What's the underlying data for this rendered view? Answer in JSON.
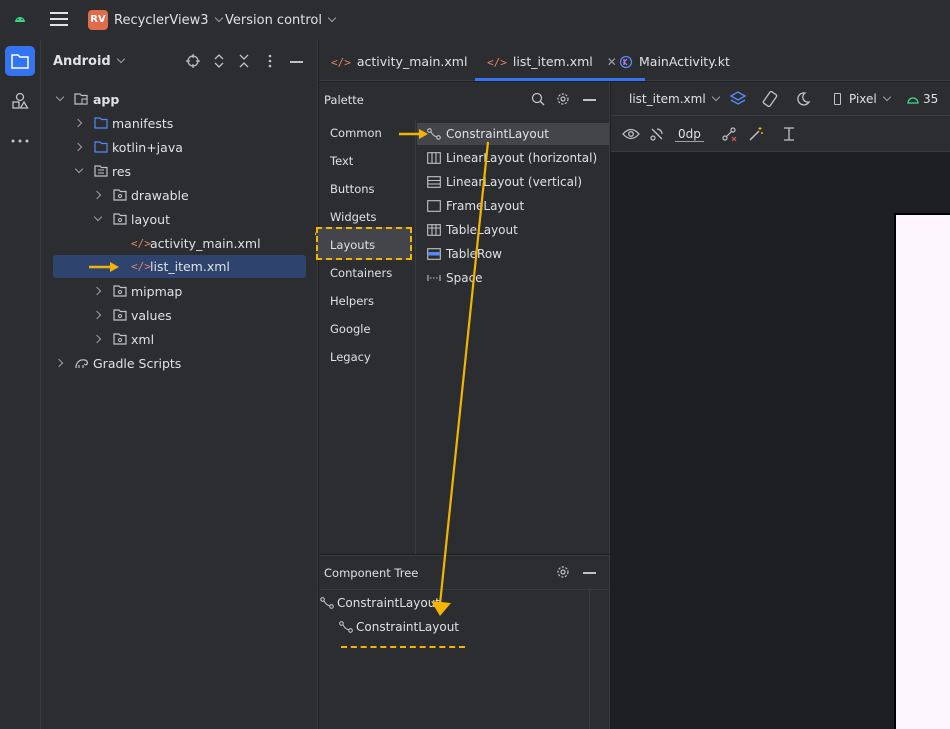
{
  "title_bar": {
    "project_badge": "RV",
    "project_name": "RecyclerView3",
    "vcs_label": "Version control"
  },
  "project_panel": {
    "view_label": "Android",
    "tree": [
      {
        "label": "app",
        "depth": 0,
        "expanded": true,
        "icon": "module-folder-icon"
      },
      {
        "label": "manifests",
        "depth": 1,
        "expanded": false,
        "icon": "folder-icon"
      },
      {
        "label": "kotlin+java",
        "depth": 1,
        "expanded": false,
        "icon": "folder-icon"
      },
      {
        "label": "res",
        "depth": 1,
        "expanded": true,
        "icon": "res-folder-icon"
      },
      {
        "label": "drawable",
        "depth": 2,
        "expanded": false,
        "icon": "res-folder-icon"
      },
      {
        "label": "layout",
        "depth": 2,
        "expanded": true,
        "icon": "res-folder-icon"
      },
      {
        "label": "activity_main.xml",
        "depth": 3,
        "icon": "xml-file-icon"
      },
      {
        "label": "list_item.xml",
        "depth": 3,
        "icon": "xml-file-icon",
        "selected": true
      },
      {
        "label": "mipmap",
        "depth": 2,
        "expanded": false,
        "icon": "res-folder-icon"
      },
      {
        "label": "values",
        "depth": 2,
        "expanded": false,
        "icon": "res-folder-icon"
      },
      {
        "label": "xml",
        "depth": 2,
        "expanded": false,
        "icon": "res-folder-icon"
      },
      {
        "label": "Gradle Scripts",
        "depth": 0,
        "expanded": false,
        "icon": "gradle-icon"
      }
    ]
  },
  "tabs": [
    {
      "label": "activity_main.xml",
      "icon": "xml-file-icon"
    },
    {
      "label": "list_item.xml",
      "icon": "xml-file-icon",
      "active": true
    },
    {
      "label": "MainActivity.kt",
      "icon": "kotlin-file-icon"
    }
  ],
  "palette": {
    "header": "Palette",
    "categories": [
      "Common",
      "Text",
      "Buttons",
      "Widgets",
      "Layouts",
      "Containers",
      "Helpers",
      "Google",
      "Legacy"
    ],
    "selected_category": "Layouts",
    "widgets": [
      {
        "label": "ConstraintLayout",
        "icon": "constraint-layout-icon",
        "selected": true
      },
      {
        "label": "LinearLayout (horizontal)",
        "icon": "linear-horizontal-icon"
      },
      {
        "label": "LinearLayout (vertical)",
        "icon": "linear-vertical-icon"
      },
      {
        "label": "FrameLayout",
        "icon": "frame-layout-icon"
      },
      {
        "label": "TableLayout",
        "icon": "table-layout-icon"
      },
      {
        "label": "TableRow",
        "icon": "table-row-icon"
      },
      {
        "label": "Space",
        "icon": "space-icon"
      }
    ]
  },
  "component_tree": {
    "header": "Component Tree",
    "items": [
      {
        "label": "ConstraintLayout",
        "depth": 0
      },
      {
        "label": "ConstraintLayout",
        "depth": 1
      }
    ]
  },
  "design_toolbar": {
    "file_selector": "list_item.xml",
    "device": "Pixel",
    "api_level": "35",
    "margin_value": "0dp"
  },
  "colors": {
    "accent": "#3574f0",
    "annotation": "#f5b400",
    "xml_icon": "#e0895e",
    "background": "#2b2d30"
  }
}
